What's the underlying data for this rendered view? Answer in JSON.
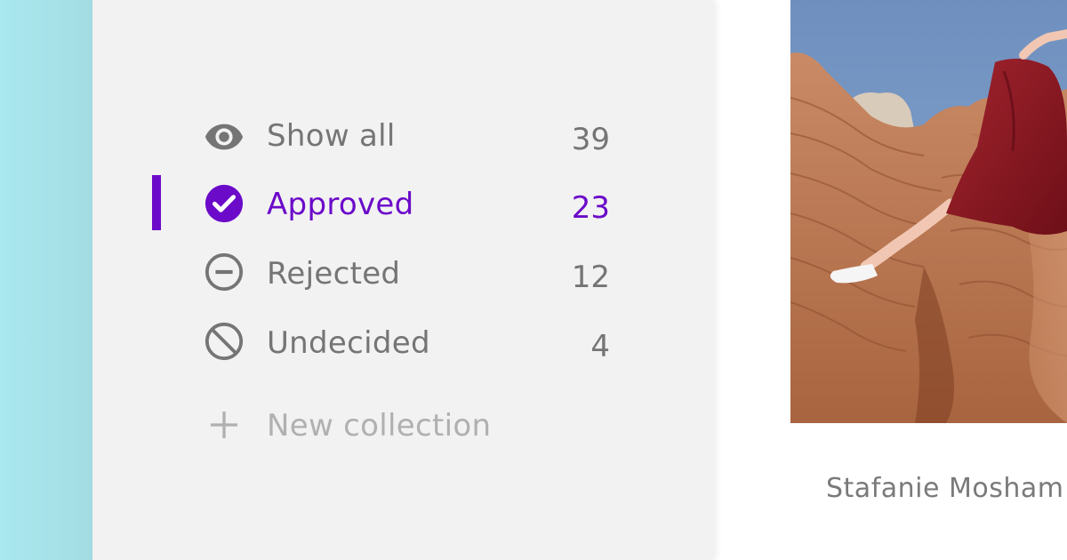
{
  "filters": {
    "items": [
      {
        "label": "Show all",
        "count": "39",
        "icon": "eye-icon",
        "active": false
      },
      {
        "label": "Approved",
        "count": "23",
        "icon": "check-circle-icon",
        "active": true
      },
      {
        "label": "Rejected",
        "count": "12",
        "icon": "minus-circle-icon",
        "active": false
      },
      {
        "label": "Undecided",
        "count": "4",
        "icon": "block-icon",
        "active": false
      }
    ],
    "new_collection_label": "New collection",
    "new_collection_icon": "plus-icon"
  },
  "photo": {
    "caption": "Stafanie Mosham",
    "subject": "person in red dress leaping over red rock canyon"
  },
  "colors": {
    "accent": "#6b0ac9",
    "text_muted": "#757575",
    "sidebar_bg": "#f2f2f2",
    "left_strip": "#a9e8ef"
  }
}
